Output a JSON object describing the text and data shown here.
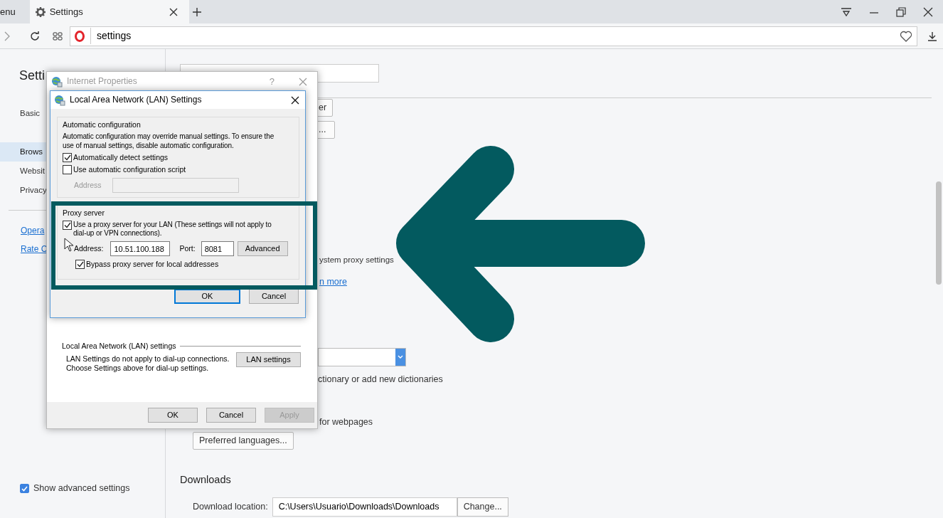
{
  "browser": {
    "tabs": [
      {
        "label": "enu",
        "selected": false
      },
      {
        "label": "Settings",
        "selected": true
      }
    ],
    "address": "settings"
  },
  "sidebar": {
    "title": "Setti",
    "items": [
      {
        "label": "Basic",
        "selected": false
      },
      {
        "label": "Brows",
        "selected": true
      },
      {
        "label": "Websit",
        "selected": false
      },
      {
        "label": "Privacy",
        "selected": false
      }
    ],
    "links": [
      "Opera",
      "Rate C"
    ],
    "advanced": {
      "label": "Show advanced settings",
      "checked": true
    }
  },
  "content": {
    "button_1": "er",
    "button_2": "...",
    "proxy_text": "ystem proxy settings",
    "proxy_link": "n more",
    "dictionary_text": "ctionary or add new dictionaries",
    "webpages_text": "for webpages",
    "languages_button": "Preferred languages...",
    "downloads": {
      "heading": "Downloads",
      "label": "Download location:",
      "value": "C:\\Users\\Usuario\\Downloads\\Downloads",
      "button": "Change..."
    }
  },
  "internet_properties": {
    "title": "Internet Properties",
    "help": "?",
    "lan_group": {
      "title": "Local Area Network (LAN) settings",
      "lines": [
        "LAN Settings do not apply to dial-up connections.",
        "Choose Settings above for dial-up settings."
      ],
      "button": "LAN settings"
    },
    "buttons": [
      {
        "label": "OK",
        "disabled": false
      },
      {
        "label": "Cancel",
        "disabled": false
      },
      {
        "label": "Apply",
        "disabled": true
      }
    ]
  },
  "lan_dialog": {
    "title": "Local Area Network (LAN) Settings",
    "auto_group": {
      "title": "Automatic configuration",
      "lines": [
        "Automatic configuration may override manual settings.  To ensure the",
        "use of manual settings, disable automatic configuration."
      ],
      "options": [
        {
          "label": "Automatically detect settings",
          "checked": true
        },
        {
          "label": "Use automatic configuration script",
          "checked": false
        }
      ],
      "address": {
        "label": "Address",
        "disabled": true
      }
    },
    "proxy_group": {
      "title": "Proxy server",
      "use_proxy": {
        "lines": [
          "Use a proxy server for your LAN (These settings will not apply to",
          "dial-up or VPN connections)."
        ],
        "checked": true
      },
      "address_label": "Address:",
      "address": "10.51.100.188",
      "port_label": "Port:",
      "port": "8081",
      "advanced": "Advanced",
      "bypass": {
        "label": "Bypass proxy server for local addresses",
        "checked": true
      }
    },
    "buttons": [
      {
        "label": "OK",
        "default": true
      },
      {
        "label": "Cancel",
        "default": false
      }
    ]
  }
}
